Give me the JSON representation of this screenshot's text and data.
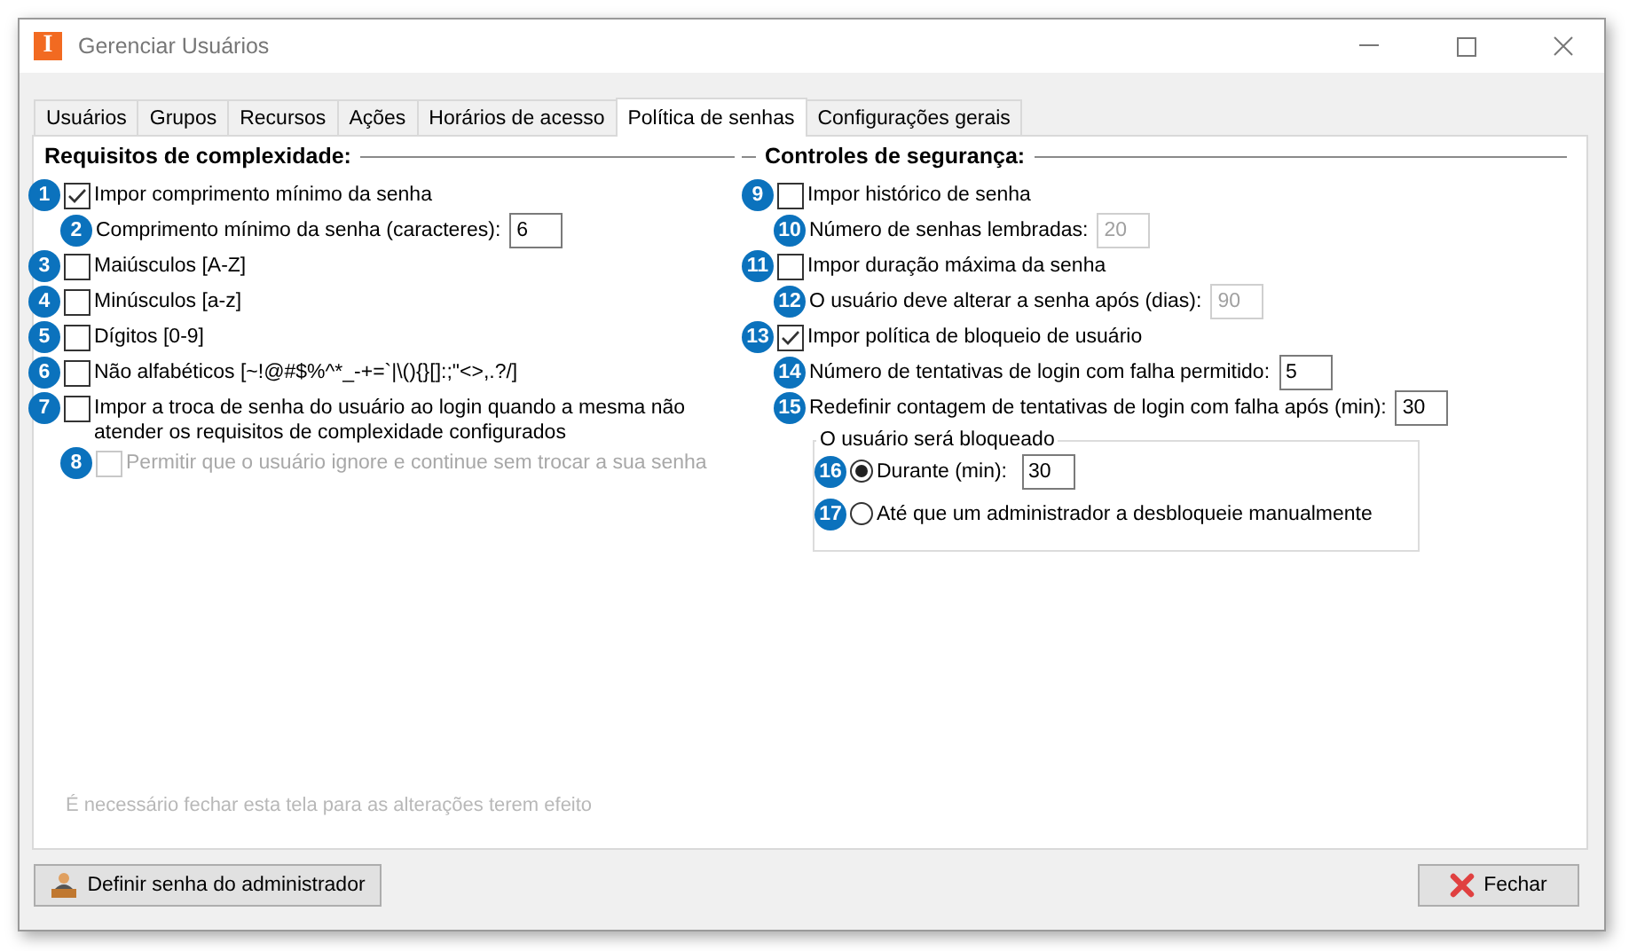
{
  "window": {
    "title": "Gerenciar Usuários",
    "logo": "I"
  },
  "tabs": [
    {
      "label": "Usuários",
      "selected": false
    },
    {
      "label": "Grupos",
      "selected": false
    },
    {
      "label": "Recursos",
      "selected": false
    },
    {
      "label": "Ações",
      "selected": false
    },
    {
      "label": "Horários de acesso",
      "selected": false
    },
    {
      "label": "Política de senhas",
      "selected": true
    },
    {
      "label": "Configurações gerais",
      "selected": false
    }
  ],
  "complexity": {
    "title": "Requisitos de complexidade:",
    "items": [
      {
        "kind": "checkbox",
        "badge": "1",
        "label": "Impor comprimento mínimo da senha",
        "checked": true,
        "disabled": false,
        "children": [
          {
            "kind": "number",
            "badge": "2",
            "label": "Comprimento mínimo da senha (caracteres):",
            "value": "6",
            "disabled": false
          }
        ]
      },
      {
        "kind": "checkbox",
        "badge": "3",
        "label": "Maiúsculos [A-Z]",
        "checked": false,
        "disabled": false
      },
      {
        "kind": "checkbox",
        "badge": "4",
        "label": "Minúsculos [a-z]",
        "checked": false,
        "disabled": false
      },
      {
        "kind": "checkbox",
        "badge": "5",
        "label": "Dígitos [0-9]",
        "checked": false,
        "disabled": false
      },
      {
        "kind": "checkbox",
        "badge": "6",
        "label": "Não alfabéticos [~!@#$%^*_-+=`|\\(){}[]:;\"<>,.?/]",
        "checked": false,
        "disabled": false
      },
      {
        "kind": "checkbox",
        "badge": "7",
        "label": "Impor a troca de senha do usuário ao login quando a mesma não atender os requisitos de complexidade configurados",
        "checked": false,
        "disabled": false,
        "children": [
          {
            "kind": "checkbox",
            "badge": "8",
            "label": "Permitir que o usuário ignore e continue sem trocar a sua senha",
            "checked": false,
            "disabled": true
          }
        ]
      }
    ]
  },
  "security": {
    "title": "Controles de segurança:",
    "items": [
      {
        "kind": "checkbox",
        "badge": "9",
        "label": "Impor histórico de senha",
        "checked": false,
        "disabled": false,
        "children": [
          {
            "kind": "number",
            "badge": "10",
            "label": "Número de senhas lembradas:",
            "value": "20",
            "disabled": true
          }
        ]
      },
      {
        "kind": "checkbox",
        "badge": "11",
        "label": "Impor duração máxima da senha",
        "checked": false,
        "disabled": false,
        "children": [
          {
            "kind": "number",
            "badge": "12",
            "label": "O usuário deve alterar a senha após (dias):",
            "value": "90",
            "disabled": true
          }
        ]
      },
      {
        "kind": "checkbox",
        "badge": "13",
        "label": "Impor política de bloqueio de usuário",
        "checked": true,
        "disabled": false,
        "children": [
          {
            "kind": "number",
            "badge": "14",
            "label": "Número de tentativas de login com falha permitido:",
            "value": "5",
            "disabled": false
          },
          {
            "kind": "number",
            "badge": "15",
            "label": "Redefinir contagem de tentativas de login com falha após (min):",
            "value": "30",
            "disabled": false
          },
          {
            "kind": "group",
            "title": "O usuário será bloqueado",
            "options": [
              {
                "badge": "16",
                "label": "Durante (min):",
                "selected": true,
                "value": "30"
              },
              {
                "badge": "17",
                "label": "Até que um administrador a desbloqueie manualmente",
                "selected": false
              }
            ]
          }
        ]
      }
    ]
  },
  "note": "É necessário fechar esta tela para as alterações terem efeito",
  "buttons": [
    {
      "kind": "admin",
      "label": "Definir senha do administrador"
    },
    {
      "kind": "close",
      "label": "Fechar"
    }
  ]
}
